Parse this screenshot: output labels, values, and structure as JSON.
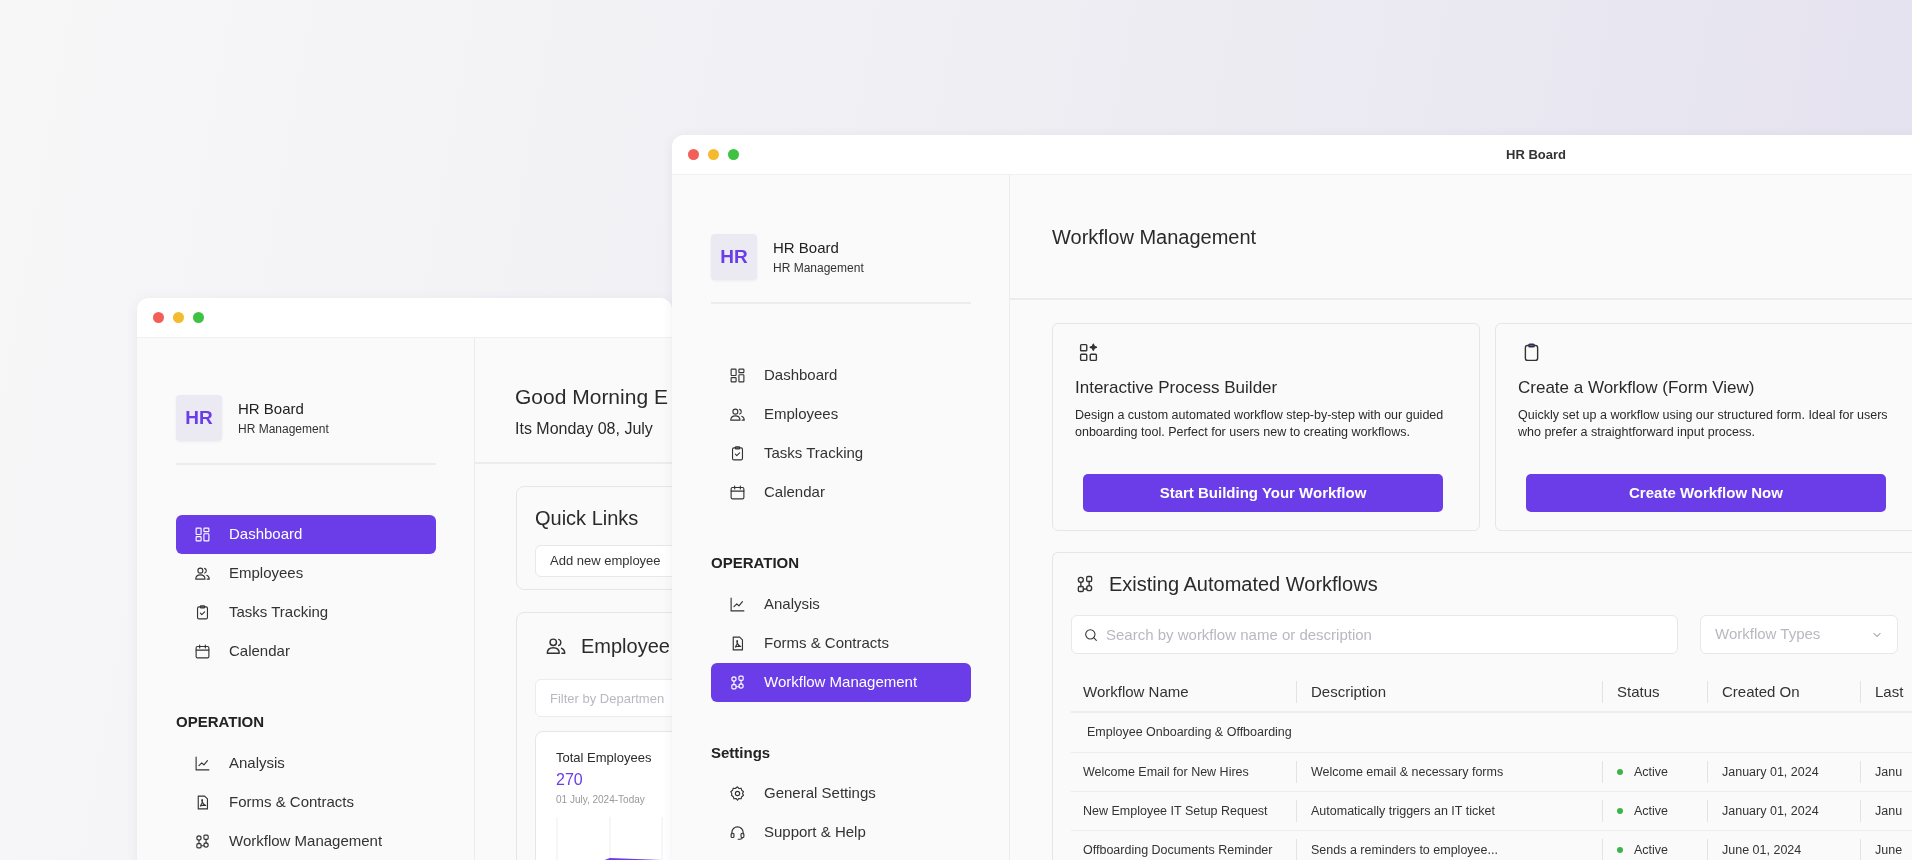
{
  "back_window": {
    "sidebar": {
      "brand": {
        "logo": "HR",
        "name": "HR Board",
        "subtitle": "HR Management"
      },
      "sections": [
        {
          "items": [
            {
              "label": "Dashboard",
              "selected": true
            },
            {
              "label": "Employees",
              "selected": false
            },
            {
              "label": "Tasks Tracking",
              "selected": false
            },
            {
              "label": "Calendar",
              "selected": false
            }
          ]
        },
        {
          "heading": "OPERATION",
          "items": [
            {
              "label": "Analysis",
              "selected": false
            },
            {
              "label": "Forms & Contracts",
              "selected": false
            },
            {
              "label": "Workflow Management",
              "selected": false
            }
          ]
        }
      ]
    },
    "greeting": "Good Morning E",
    "date": "Its Monday 08, July",
    "quick_links": {
      "title": "Quick Links",
      "links": [
        "Add new employee"
      ]
    },
    "employees": {
      "title": "Employee",
      "filter": {
        "placeholder": "Filter by Departmen"
      },
      "stat": {
        "label": "Total Employees",
        "value": "270",
        "range": "01 July, 2024-Today"
      }
    }
  },
  "front_window": {
    "title": "HR Board",
    "sidebar": {
      "brand": {
        "logo": "HR",
        "name": "HR Board",
        "subtitle": "HR Management"
      },
      "sections": [
        {
          "items": [
            {
              "label": "Dashboard",
              "selected": false
            },
            {
              "label": "Employees",
              "selected": false
            },
            {
              "label": "Tasks Tracking",
              "selected": false
            },
            {
              "label": "Calendar",
              "selected": false
            }
          ]
        },
        {
          "heading": "OPERATION",
          "items": [
            {
              "label": "Analysis",
              "selected": false
            },
            {
              "label": "Forms & Contracts",
              "selected": false
            },
            {
              "label": "Workflow Management",
              "selected": true
            }
          ]
        },
        {
          "heading": "Settings",
          "items": [
            {
              "label": "General Settings",
              "selected": false
            },
            {
              "label": "Support & Help",
              "selected": false
            }
          ]
        }
      ]
    },
    "page_title": "Workflow Management",
    "option_cards": [
      {
        "title": "Interactive Process Builder",
        "description": "Design a custom automated workflow step-by-step with our guided onboarding tool. Perfect for users new to creating workflows.",
        "button": "Start Building Your Workflow"
      },
      {
        "title": "Create a Workflow (Form View)",
        "description": "Quickly set up a workflow using our structured form. Ideal for users who prefer a straightforward input process.",
        "button": "Create Workflow Now"
      }
    ],
    "workflows": {
      "title": "Existing Automated Workflows",
      "search": {
        "placeholder": "Search by workflow name or description"
      },
      "filter": {
        "placeholder": "Workflow Types"
      },
      "table": {
        "columns": [
          "Workflow Name",
          "Description",
          "Status",
          "Created On",
          "Last"
        ],
        "groups": [
          {
            "name": "Employee Onboarding & Offboarding",
            "rows": [
              {
                "cells": [
                  "Welcome Email for New Hires",
                  "Welcome email & necessary forms",
                  "Active",
                  "January 01, 2024",
                  "Janu"
                ]
              },
              {
                "cells": [
                  "New Employee IT Setup Request",
                  "Automatically triggers an IT ticket",
                  "Active",
                  "January 01, 2024",
                  "Janu"
                ]
              },
              {
                "cells": [
                  "Offboarding Documents Reminder",
                  "Sends a reminders to employee...",
                  "Active",
                  "June 01, 2024",
                  "June"
                ]
              }
            ]
          }
        ]
      }
    }
  }
}
